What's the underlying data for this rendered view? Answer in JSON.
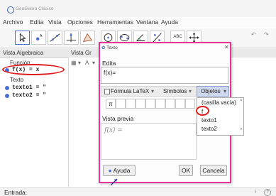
{
  "window": {
    "title": "GeoGebra Clásico"
  },
  "menu": [
    "Archivo",
    "Edita",
    "Vista",
    "Opciones",
    "Herramientas",
    "Ventana",
    "Ayuda"
  ],
  "toolbar": {
    "text_tool": "ABC"
  },
  "panels": {
    "algebra": "Vista Algebraica",
    "graphics": "Vista Gr"
  },
  "algebra": {
    "group1": "Función",
    "item1": "f(x) = x",
    "group2": "Texto",
    "item2": "texto1 = \"",
    "item3": "texto2 = \""
  },
  "dialog": {
    "title": "Texto",
    "edit_label": "Edita",
    "edit_value": "f(x)=",
    "latex_label": "Fórmula LaTeX",
    "symbols_label": "Símbolos",
    "objects_label": "Objetos",
    "pi_symbol": "π",
    "dropdown": [
      "(casilla vacía)",
      "f",
      "texto1",
      "texto2"
    ],
    "preview_label": "Vista previa",
    "preview_text": "f(x) =",
    "help_button": "Ayuda",
    "ok_button": "OK",
    "cancel_button": "Cancela"
  },
  "status": {
    "input_label": "Entrada:"
  },
  "colors": {
    "accent": "#4d6fd9",
    "dialog_border": "#e6349a",
    "highlight": "#e01b1b"
  }
}
